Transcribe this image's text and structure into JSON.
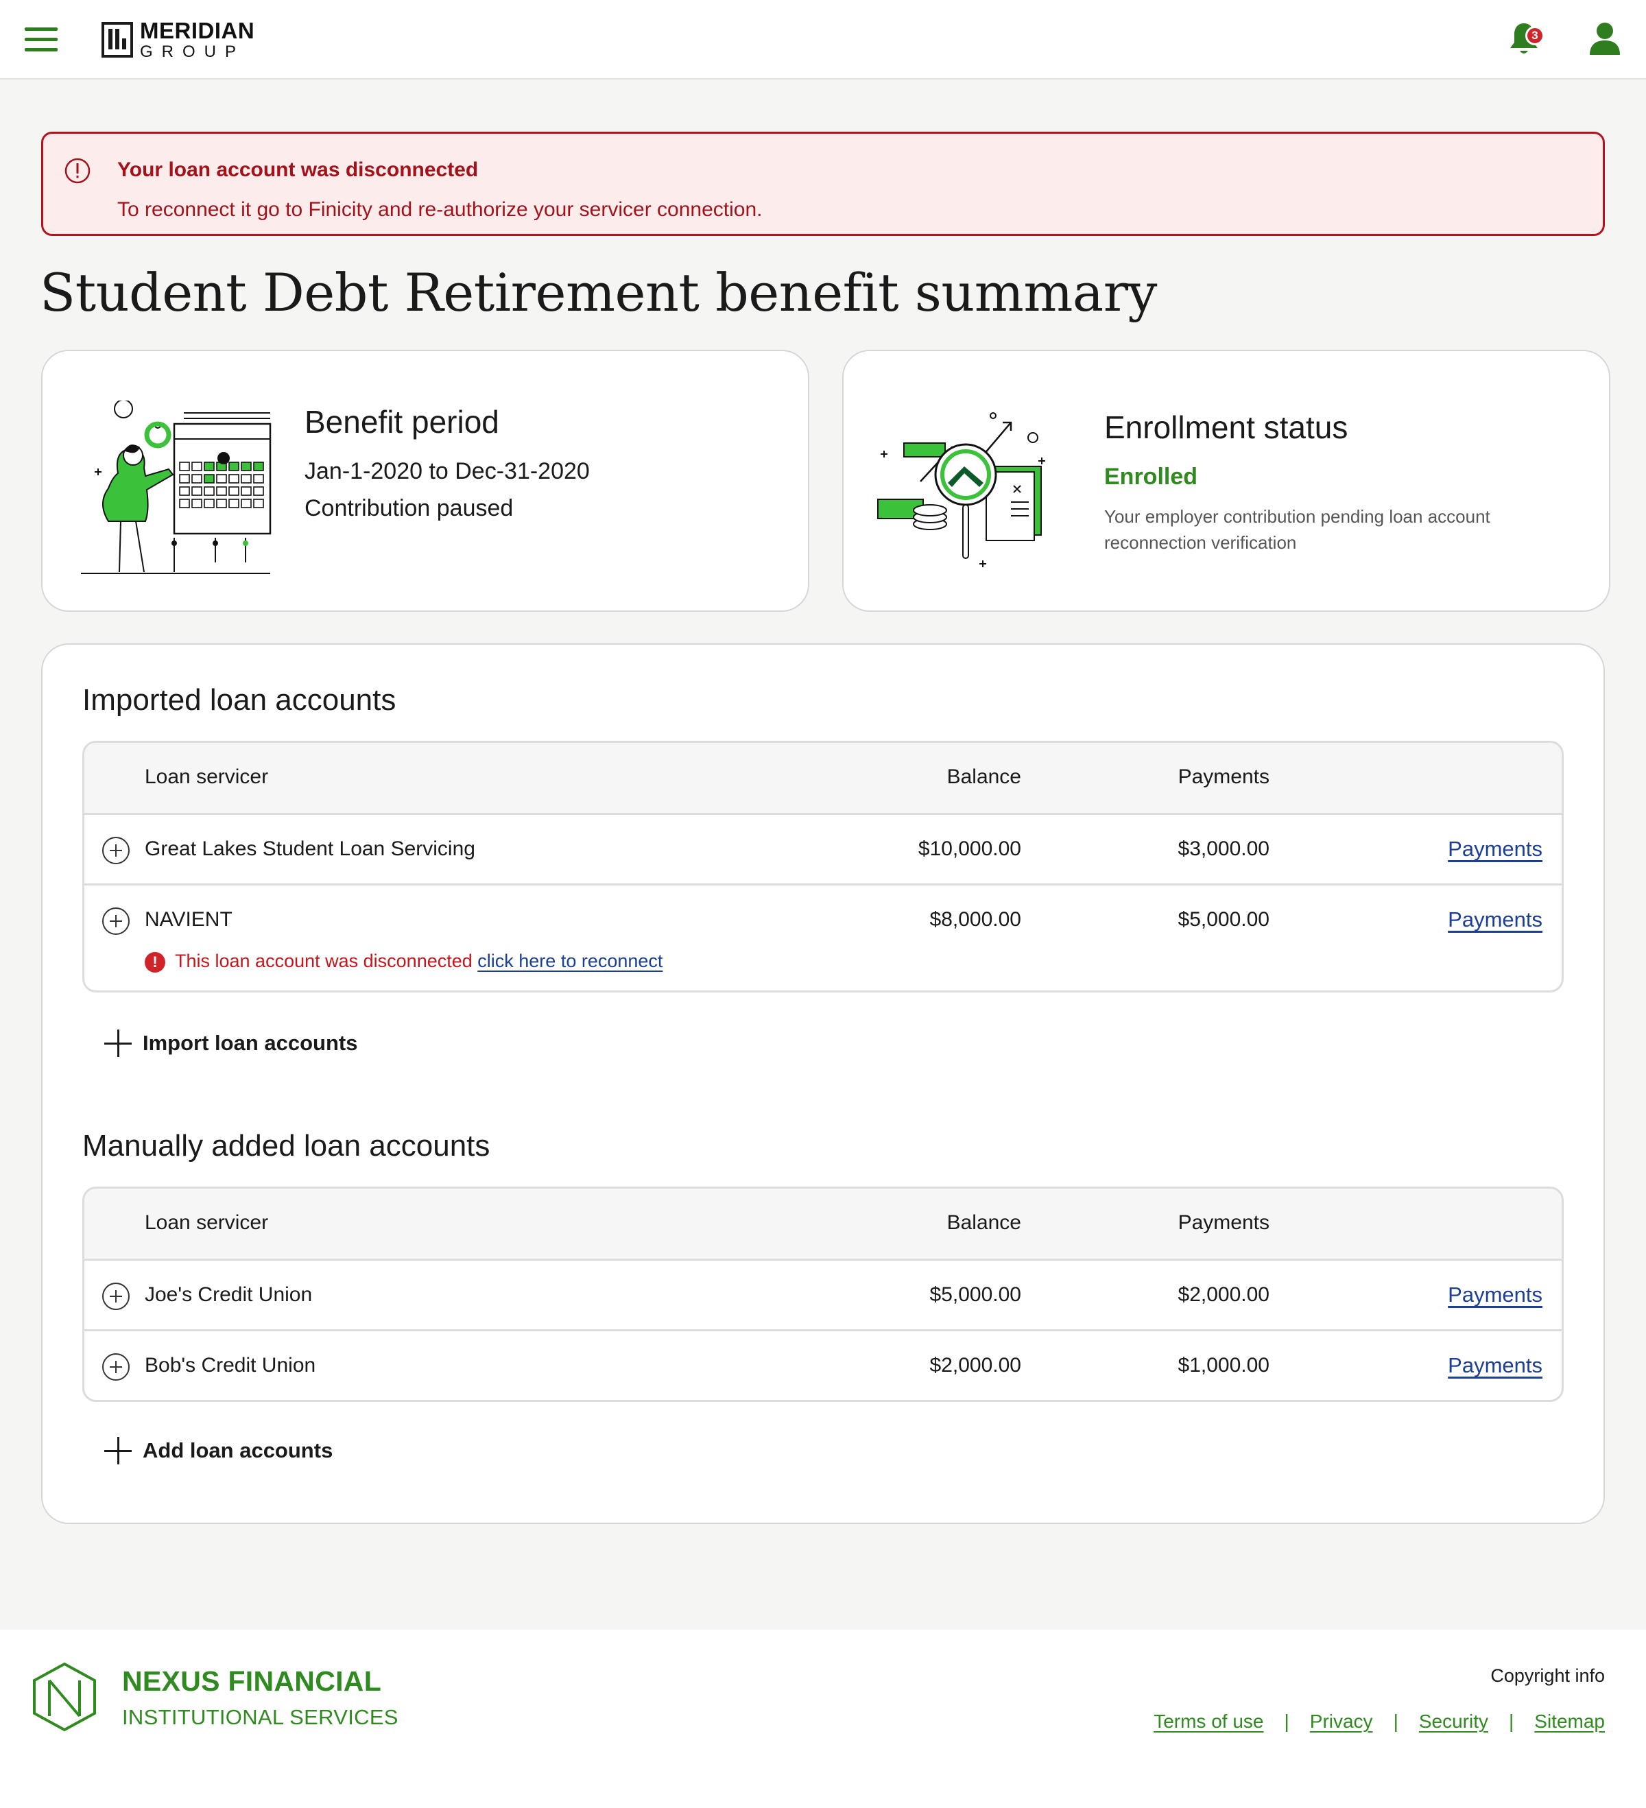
{
  "header": {
    "logo_line1": "MERIDIAN",
    "logo_line2": "GROUP",
    "notification_count": "3",
    "brand_color": "#2e7d1e"
  },
  "alert": {
    "title": "Your loan account was disconnected",
    "message": "To reconnect it go to Finicity and re-authorize your servicer connection.",
    "color": "#b3141b"
  },
  "page": {
    "title": "Student Debt Retirement benefit summary"
  },
  "benefit_card": {
    "title": "Benefit period",
    "period": "Jan-1-2020 to Dec-31-2020",
    "status": "Contribution paused"
  },
  "enrollment_card": {
    "title": "Enrollment status",
    "status": "Enrolled",
    "description": "Your employer contribution pending loan account reconnection verification"
  },
  "imported": {
    "title": "Imported loan accounts",
    "columns": [
      "Loan servicer",
      "Balance",
      "Payments"
    ],
    "rows": [
      {
        "name": "Great Lakes Student Loan Servicing",
        "balance": "$10,000.00",
        "payments": "$3,000.00",
        "link": "Payments"
      },
      {
        "name": "NAVIENT",
        "balance": "$8,000.00",
        "payments": "$5,000.00",
        "link": "Payments",
        "disconnected_text": "This loan account was disconnected",
        "reconnect_link": "click here to reconnect"
      }
    ],
    "action_label": "Import loan accounts"
  },
  "manual": {
    "title": "Manually added loan accounts",
    "columns": [
      "Loan servicer",
      "Balance",
      "Payments"
    ],
    "rows": [
      {
        "name": "Joe's Credit Union",
        "balance": "$5,000.00",
        "payments": "$2,000.00",
        "link": "Payments"
      },
      {
        "name": "Bob's Credit Union",
        "balance": "$2,000.00",
        "payments": "$1,000.00",
        "link": "Payments"
      }
    ],
    "action_label": "Add loan accounts"
  },
  "footer": {
    "brand_line1": "NEXUS FINANCIAL",
    "brand_line2": "INSTITUTIONAL SERVICES",
    "copyright": "Copyright info",
    "links": [
      "Terms of use",
      "Privacy",
      "Security",
      "Sitemap"
    ],
    "separator": "|"
  }
}
